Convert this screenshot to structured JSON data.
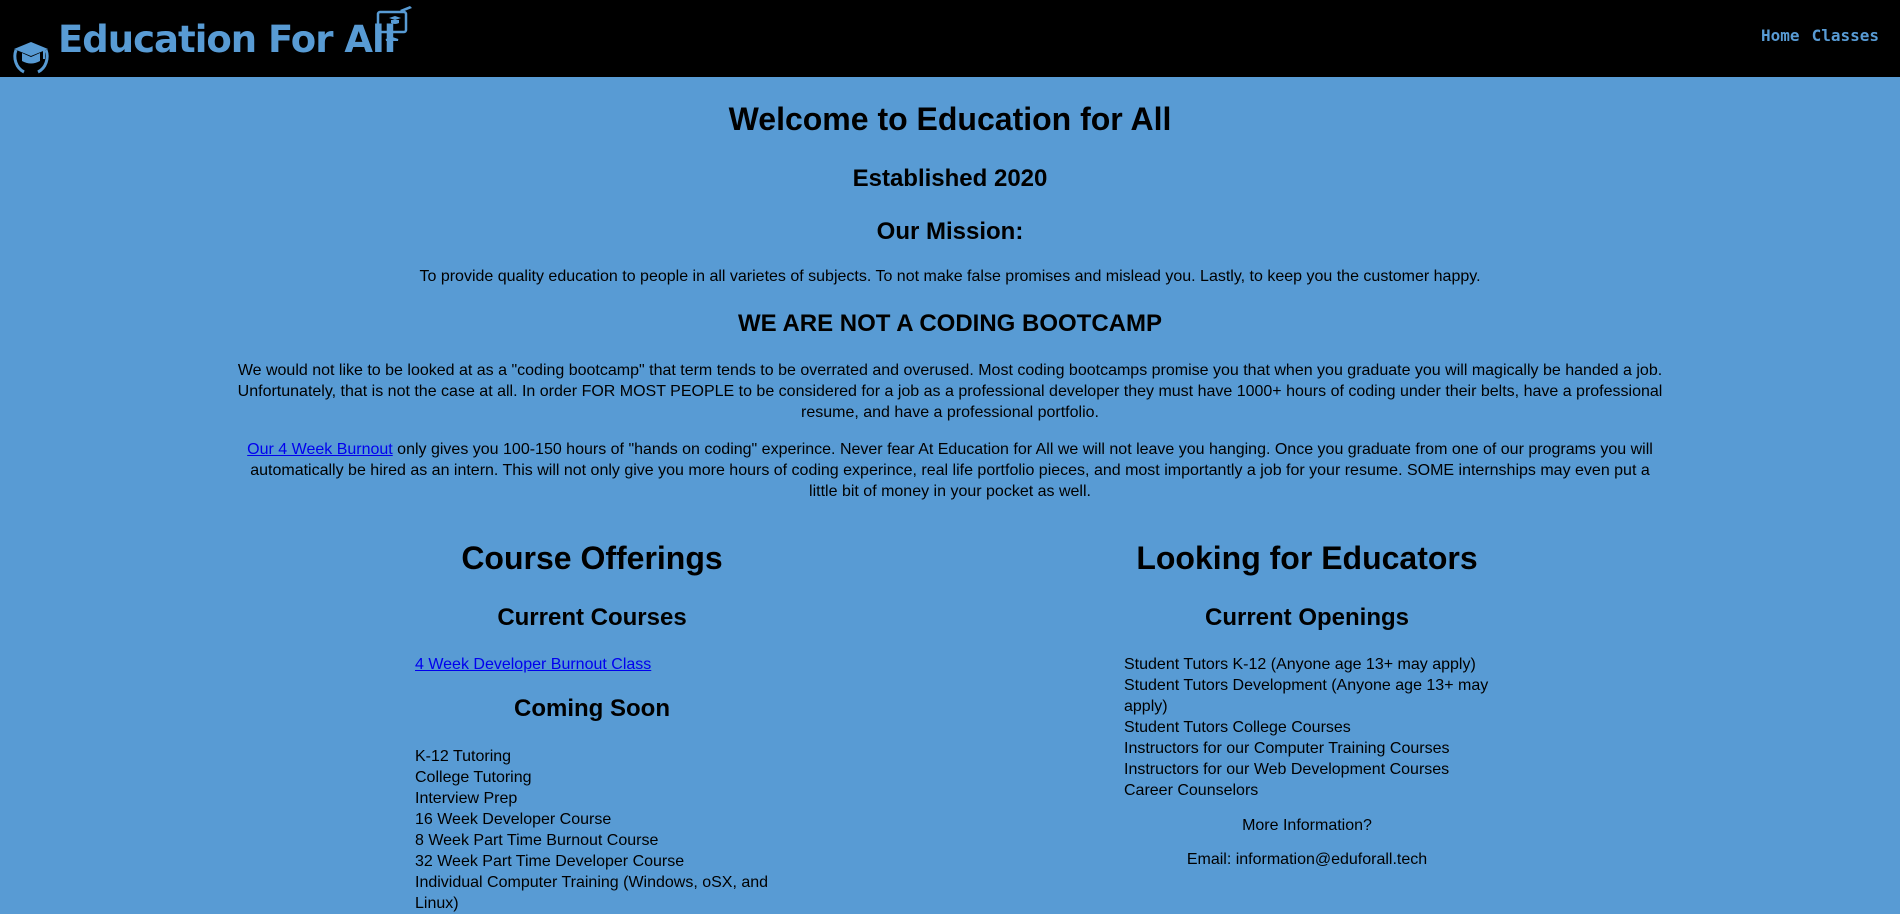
{
  "header": {
    "brand_title": "Education For All",
    "nav": [
      {
        "label": "Home"
      },
      {
        "label": "Classes"
      }
    ],
    "icons": {
      "logo": "graduation-cap-laurel-icon",
      "monitor": "monitor-grad-cap-icon"
    }
  },
  "main": {
    "welcome": "Welcome to Education for All",
    "established": "Established 2020",
    "mission_heading": "Our Mission:",
    "mission_text": "To provide quality education to people in all varietes of subjects. To not make false promises and mislead you. Lastly, to keep you the customer happy.",
    "not_bootcamp_heading": "WE ARE NOT A CODING BOOTCAMP",
    "paragraph_1": "We would not like to be looked at as a \"coding bootcamp\" that term tends to be overrated and overused. Most coding bootcamps promise you that when you graduate you will magically be handed a job. Unfortunately, that is not the case at all. In order FOR MOST PEOPLE to be considered for a job as a professional developer they must have 1000+ hours of coding under their belts, have a professional resume, and have a professional portfolio.",
    "paragraph_2_link": "Our 4 Week Burnout",
    "paragraph_2_text": " only gives you 100-150 hours of \"hands on coding\" experince. Never fear At Education for All we will not leave you hanging. Once you graduate from one of our programs you will automatically be hired as an intern. This will not only give you more hours of coding experince, real life portfolio pieces, and most importantly a job for your resume. SOME internships may even put a little bit of money in your pocket as well."
  },
  "courses": {
    "heading": "Course Offerings",
    "current_heading": "Current Courses",
    "current_link": "4 Week Developer Burnout Class",
    "coming_soon_heading": "Coming Soon",
    "coming_soon": [
      "K-12 Tutoring",
      "College Tutoring",
      "Interview Prep",
      "16 Week Developer Course",
      "8 Week Part Time Burnout Course",
      "32 Week Part Time Developer Course",
      "Individual Computer Training (Windows, oSX, and Linux)"
    ]
  },
  "educators": {
    "heading": "Looking for Educators",
    "openings_heading": "Current Openings",
    "openings": [
      "Student Tutors K-12 (Anyone age 13+ may apply)",
      "Student Tutors Development (Anyone age 13+ may apply)",
      "Student Tutors College Courses",
      "Instructors for our Computer Training Courses",
      "Instructors for our Web Development Courses",
      "Career Counselors"
    ],
    "more_info": "More Information?",
    "email": "Email: information@eduforall.tech"
  },
  "colors": {
    "background": "#589bd4",
    "header": "#000000",
    "brand": "#589bd4",
    "link": "#0000ee"
  }
}
